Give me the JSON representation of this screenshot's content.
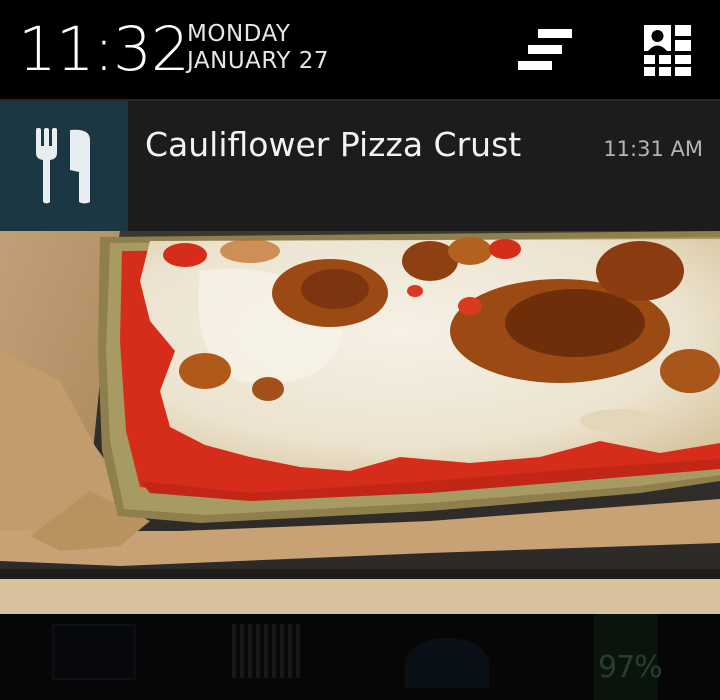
{
  "shade": {
    "time": "11:32",
    "weekday": "MONDAY",
    "date": "JANUARY 27",
    "clear_icon": "clear-all-icon",
    "settings_icon": "quick-settings-icon"
  },
  "notification": {
    "app_icon": "fork-knife-icon",
    "title": "Cauliflower Pizza Crust",
    "time": "11:31 AM",
    "image_subject": "pizza-photo",
    "accent_color": "#1c3744"
  },
  "underlay": {
    "battery_percent": "97%"
  }
}
